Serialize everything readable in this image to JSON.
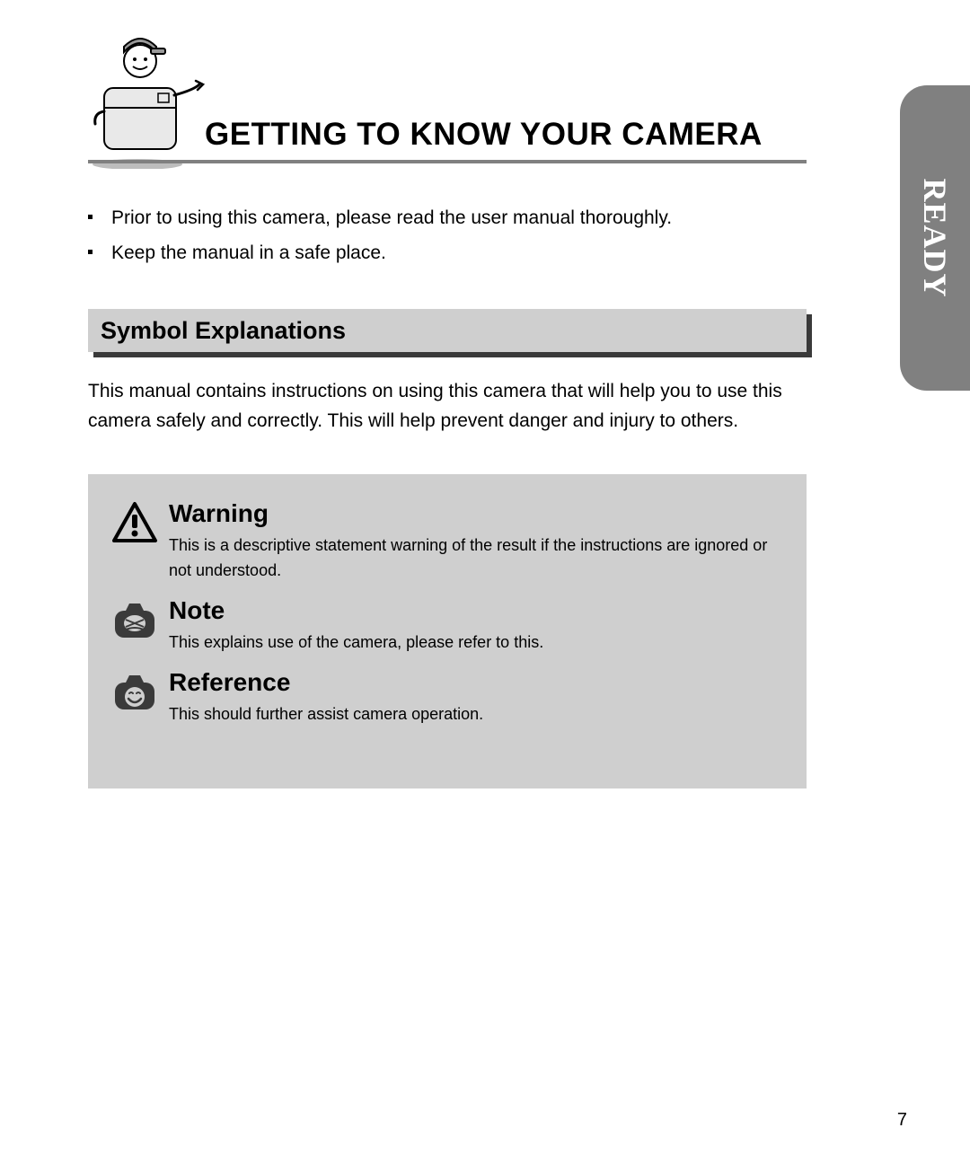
{
  "side_tab": {
    "label": "READY"
  },
  "header": {
    "title": "GETTING TO KNOW YOUR CAMERA"
  },
  "intro": {
    "items": [
      "Prior to using this camera, please read the user manual thoroughly.",
      "Keep the manual in a safe place."
    ]
  },
  "section": {
    "heading": "Symbol Explanations",
    "paragraph": "This manual contains instructions on using this camera that will help you to use this camera safely and correctly. This will help prevent danger and injury to others."
  },
  "symbols": [
    {
      "icon": "warning-triangle-icon",
      "title": "Warning",
      "desc": "This is a descriptive statement warning of the result if the instructions are ignored or not understood."
    },
    {
      "icon": "camera-note-icon",
      "title": "Note",
      "desc": "This explains use of the camera, please refer to this."
    },
    {
      "icon": "camera-reference-icon",
      "title": "Reference",
      "desc": "This should further assist camera operation."
    }
  ],
  "page_number": "7"
}
